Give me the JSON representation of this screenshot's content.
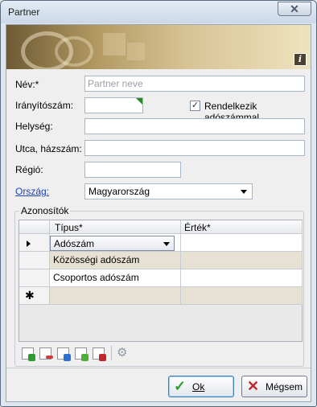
{
  "window": {
    "title": "Partner",
    "close_glyph": "✕"
  },
  "banner": {
    "info_icon": "i"
  },
  "form": {
    "nev_label": "Név:*",
    "nev_placeholder": "Partner neve",
    "iranyito_label": "Irányítószám:",
    "adoszam_checkbox_label": "Rendelkezik adószámmal",
    "adoszam_checked": true,
    "helyseg_label": "Helység:",
    "utca_label": "Utca, házszám:",
    "regio_label": "Régió:",
    "orszag_label": "Ország:",
    "orszag_value": "Magyarország"
  },
  "azonositok": {
    "title": "Azonosítók",
    "columns": [
      "Típus*",
      "Érték*"
    ],
    "rows": [
      {
        "tipus": "Adószám",
        "ertek": ""
      },
      {
        "tipus": "Közösségi adószám",
        "ertek": ""
      },
      {
        "tipus": "Csoportos adószám",
        "ertek": ""
      }
    ],
    "new_row_marker": "✱",
    "toolbar": [
      "add-row-icon",
      "delete-row-icon",
      "move-row-icon",
      "edit-row-icon",
      "remove-row-icon",
      "settings-icon"
    ]
  },
  "buttons": {
    "ok_label": "Ok",
    "cancel_label": "Mégsem"
  },
  "colors": {
    "accent_link": "#1a3fb8",
    "required_marker": "#2a8a2a",
    "ok_green": "#2e9b2e",
    "cancel_red": "#c0262b"
  }
}
